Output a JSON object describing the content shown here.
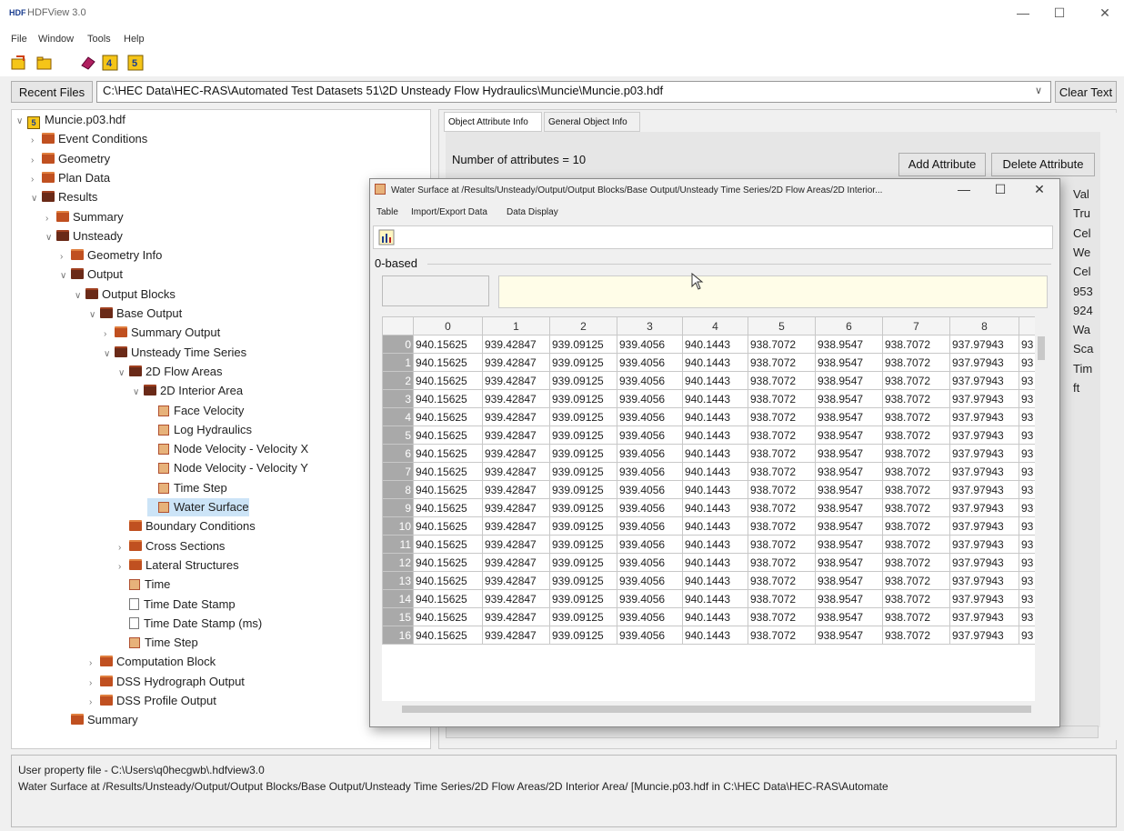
{
  "window": {
    "title": "HDFView 3.0",
    "logo_text": "HDF",
    "minimize": "—",
    "maximize": "☐",
    "close": "✕"
  },
  "menu": [
    "File",
    "Window",
    "Tools",
    "Help"
  ],
  "recent": {
    "button": "Recent Files",
    "path": "C:\\HEC Data\\HEC-RAS\\Automated Test Datasets 51\\2D Unsteady Flow Hydraulics\\Muncie\\Muncie.p03.hdf",
    "clear": "Clear Text",
    "dropdown": "∨"
  },
  "tree": [
    {
      "label": "Muncie.p03.hdf",
      "chev": "∨",
      "icon": "h5"
    },
    {
      "label": "Event Conditions",
      "chev": "›",
      "icon": "fc"
    },
    {
      "label": "Geometry",
      "chev": "›",
      "icon": "fc"
    },
    {
      "label": "Plan Data",
      "chev": "›",
      "icon": "fc"
    },
    {
      "label": "Results",
      "chev": "∨",
      "icon": "fo"
    },
    {
      "label": "Summary",
      "chev": "›",
      "icon": "fc"
    },
    {
      "label": "Unsteady",
      "chev": "∨",
      "icon": "fo"
    },
    {
      "label": "Geometry Info",
      "chev": "›",
      "icon": "fc"
    },
    {
      "label": "Output",
      "chev": "∨",
      "icon": "fo"
    },
    {
      "label": "Output Blocks",
      "chev": "∨",
      "icon": "fo"
    },
    {
      "label": "Base Output",
      "chev": "∨",
      "icon": "fo"
    },
    {
      "label": "Summary Output",
      "chev": "›",
      "icon": "fc"
    },
    {
      "label": "Unsteady Time Series",
      "chev": "∨",
      "icon": "fo"
    },
    {
      "label": "2D Flow Areas",
      "chev": "∨",
      "icon": "fo"
    },
    {
      "label": "2D Interior Area",
      "chev": "∨",
      "icon": "fo"
    },
    {
      "label": "Face Velocity",
      "chev": "",
      "icon": "ds"
    },
    {
      "label": "Log Hydraulics",
      "chev": "",
      "icon": "ds"
    },
    {
      "label": "Node Velocity - Velocity X",
      "chev": "",
      "icon": "ds"
    },
    {
      "label": "Node Velocity - Velocity Y",
      "chev": "",
      "icon": "ds"
    },
    {
      "label": "Time Step",
      "chev": "",
      "icon": "ds"
    },
    {
      "label": "Water Surface",
      "chev": "",
      "icon": "ds"
    },
    {
      "label": "Boundary Conditions",
      "chev": "",
      "icon": "fc"
    },
    {
      "label": "Cross Sections",
      "chev": "›",
      "icon": "fc"
    },
    {
      "label": "Lateral Structures",
      "chev": "›",
      "icon": "fc"
    },
    {
      "label": "Time",
      "chev": "",
      "icon": "ds"
    },
    {
      "label": "Time Date Stamp",
      "chev": "",
      "icon": "file"
    },
    {
      "label": "Time Date Stamp (ms)",
      "chev": "",
      "icon": "file"
    },
    {
      "label": "Time Step",
      "chev": "",
      "icon": "ds"
    },
    {
      "label": "Computation Block",
      "chev": "›",
      "icon": "fc"
    },
    {
      "label": "DSS Hydrograph Output",
      "chev": "›",
      "icon": "fc"
    },
    {
      "label": "DSS Profile Output",
      "chev": "›",
      "icon": "fc"
    },
    {
      "label": "Summary",
      "chev": "",
      "icon": "fc"
    }
  ],
  "tabs": [
    "Object Attribute Info",
    "General Object Info"
  ],
  "attributes": {
    "count_label": "Number of attributes = 10",
    "add": "Add Attribute",
    "delete": "Delete Attribute",
    "side_values": [
      "Val",
      "Tru",
      "Cel",
      "We",
      "Cel",
      "953",
      "924",
      "Wa",
      "Sca",
      "Tim",
      "ft"
    ]
  },
  "viewer": {
    "title": "Water Surface  at  /Results/Unsteady/Output/Output Blocks/Base Output/Unsteady Time Series/2D Flow Areas/2D Interior...",
    "menu": [
      "Table",
      "Import/Export Data",
      "Data Display"
    ],
    "index_mode": "0-based",
    "columns": [
      "0",
      "1",
      "2",
      "3",
      "4",
      "5",
      "6",
      "7",
      "8"
    ],
    "row_values": [
      "940.15625",
      "939.42847",
      "939.09125",
      "939.4056",
      "940.1443",
      "938.7072",
      "938.9547",
      "938.7072",
      "937.97943",
      "93"
    ],
    "row_count": 17
  },
  "status": {
    "line1": "User property file - C:\\Users\\q0hecgwb\\.hdfview3.0",
    "line2": "Water Surface  at  /Results/Unsteady/Output/Output Blocks/Base Output/Unsteady Time Series/2D Flow Areas/2D Interior Area/  [Muncie.p03.hdf  in  C:\\HEC Data\\HEC-RAS\\Automate"
  }
}
